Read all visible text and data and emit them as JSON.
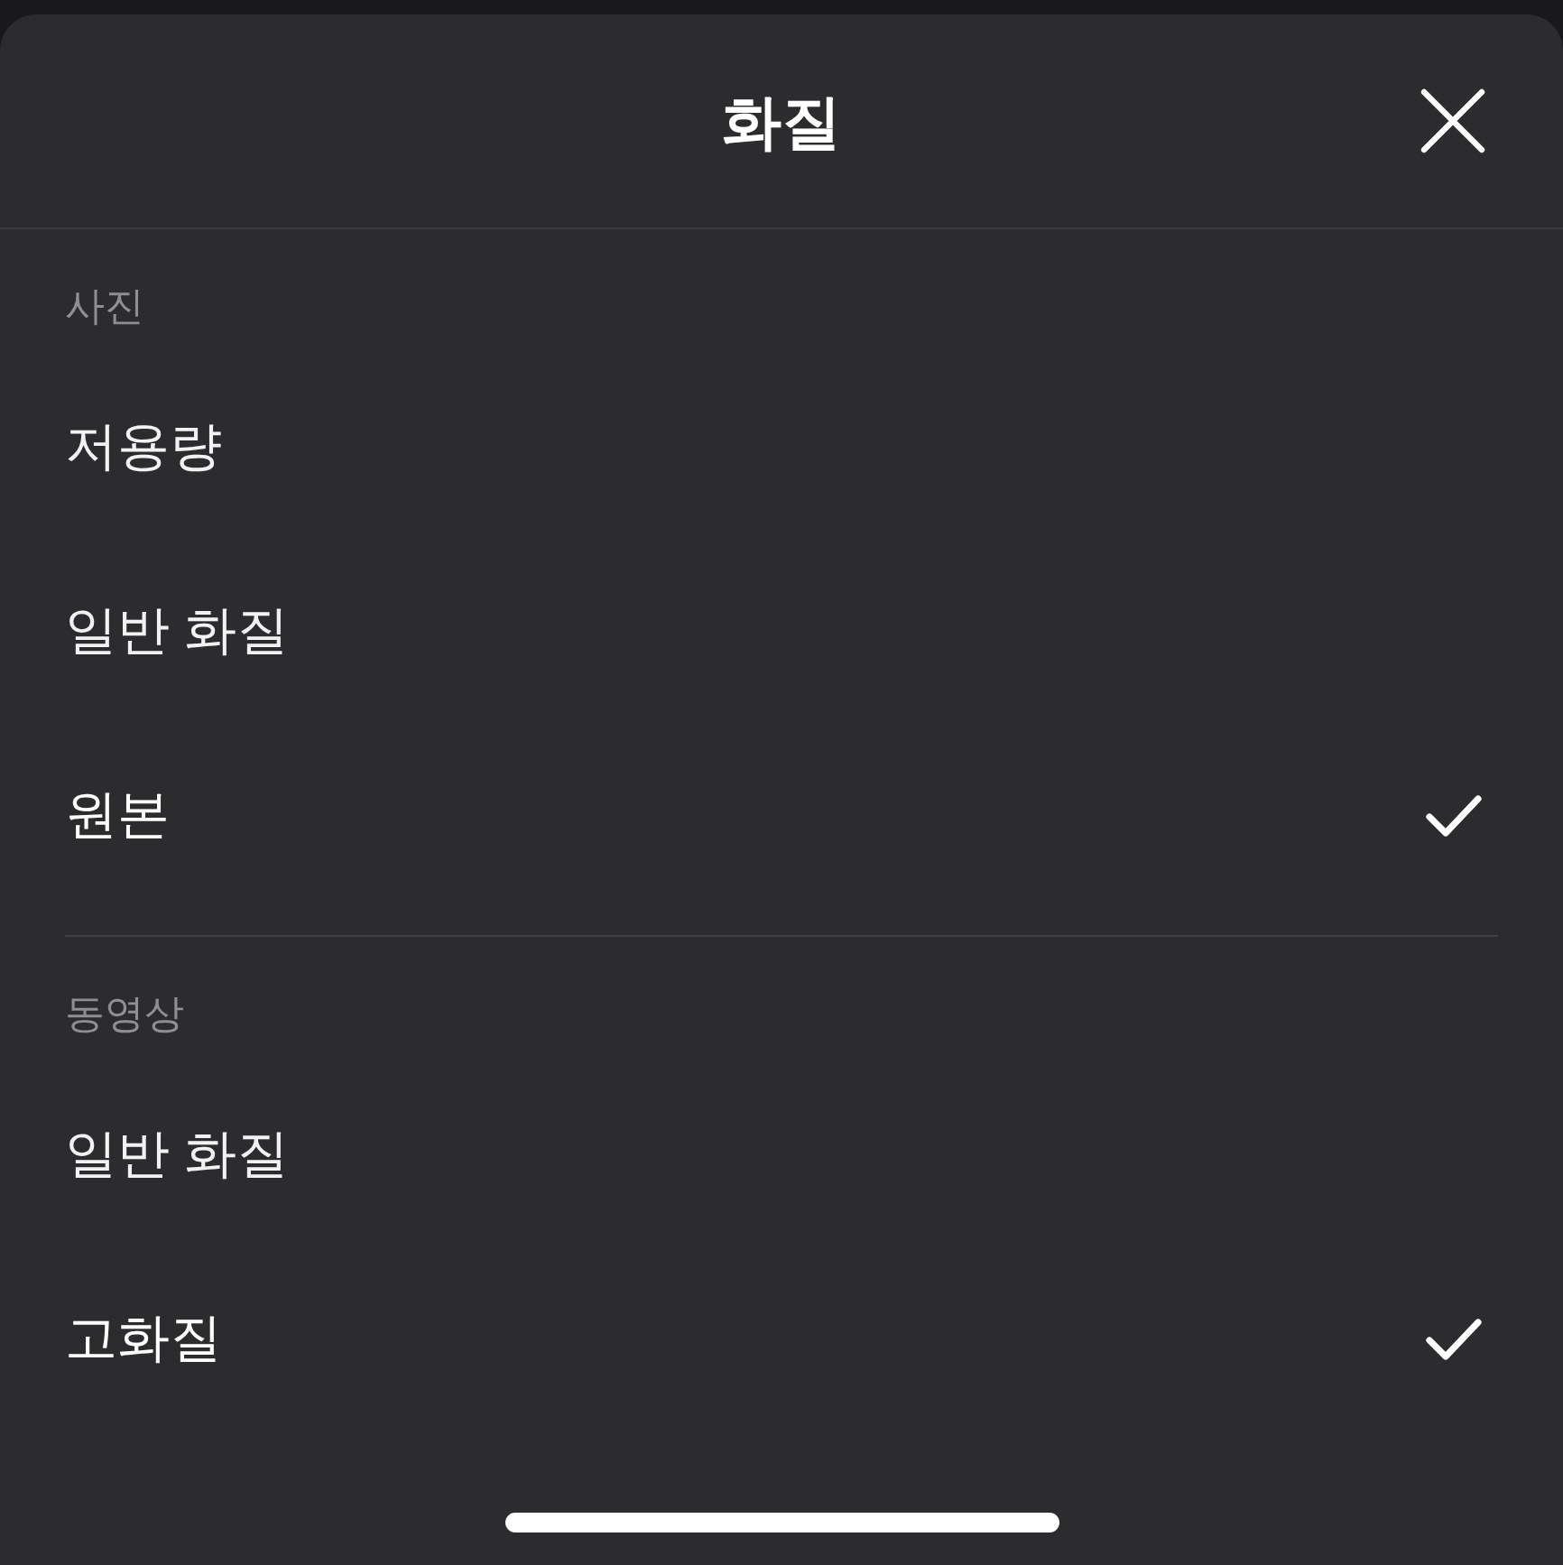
{
  "header": {
    "title": "화질"
  },
  "sections": [
    {
      "label": "사진",
      "options": [
        {
          "label": "저용량",
          "selected": false
        },
        {
          "label": "일반 화질",
          "selected": false
        },
        {
          "label": "원본",
          "selected": true
        }
      ]
    },
    {
      "label": "동영상",
      "options": [
        {
          "label": "일반 화질",
          "selected": false
        },
        {
          "label": "고화질",
          "selected": true
        }
      ]
    }
  ]
}
